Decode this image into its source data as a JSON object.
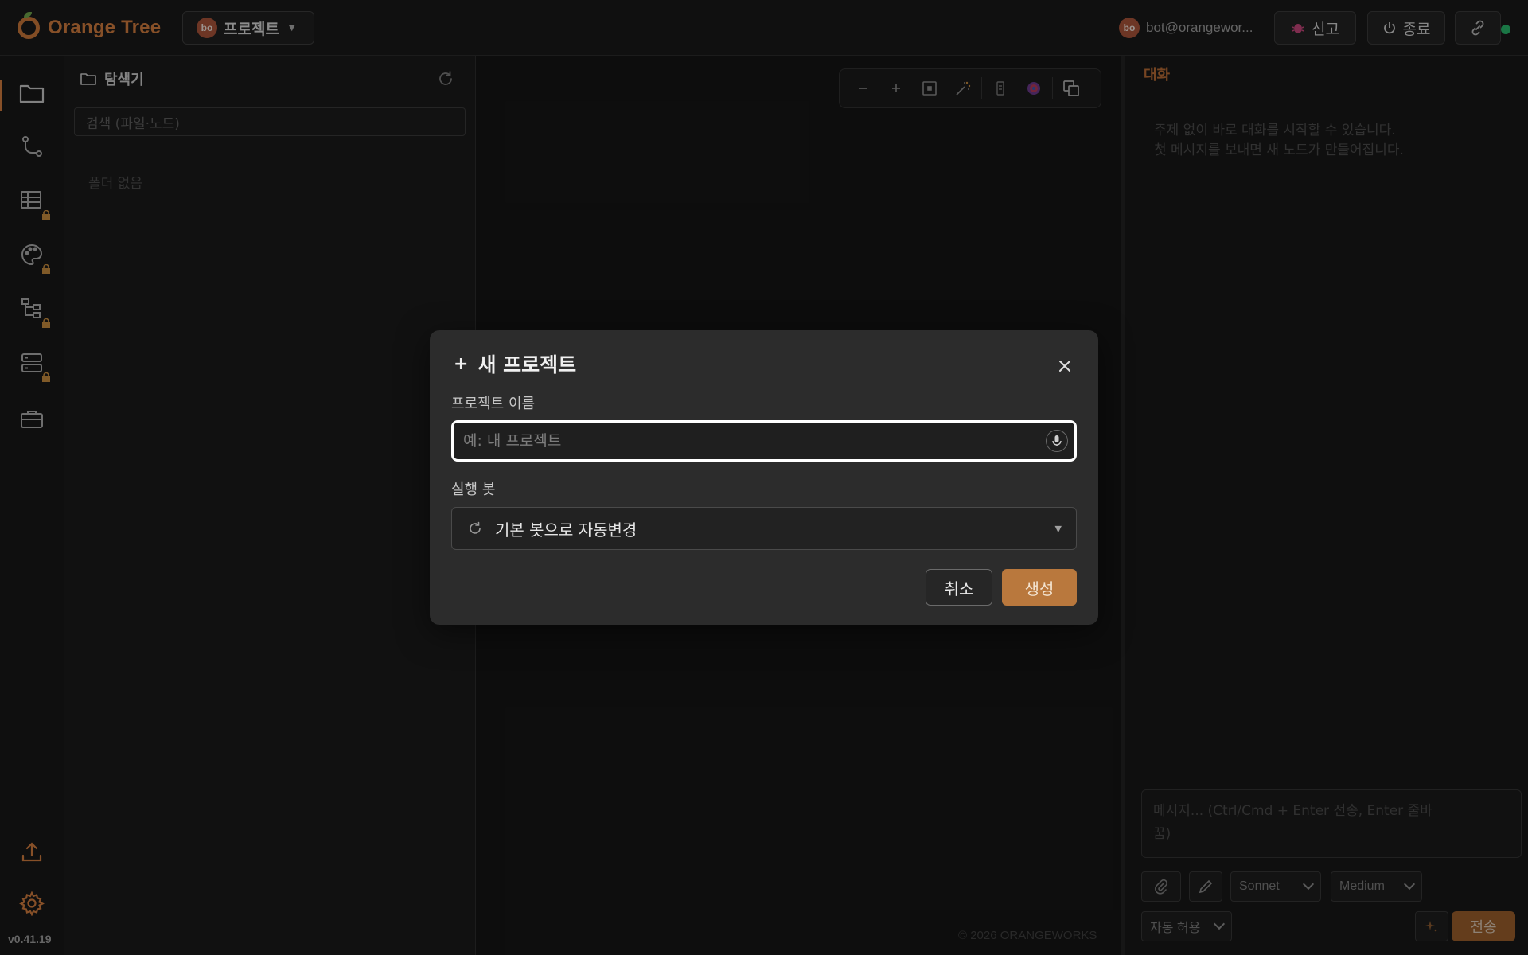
{
  "app": {
    "name": "Orange Tree"
  },
  "header": {
    "project_avatar": "bo",
    "project_label": "프로젝트",
    "user_avatar": "bo",
    "user_email": "bot@orangewor...",
    "report_label": "신고",
    "quit_label": "종료",
    "status_color": "#28b66a"
  },
  "rail": {
    "items": [
      {
        "icon": "folder-icon",
        "locked": false,
        "active": true
      },
      {
        "icon": "git-branch-icon",
        "locked": false
      },
      {
        "icon": "table-icon",
        "locked": true
      },
      {
        "icon": "palette-icon",
        "locked": true
      },
      {
        "icon": "hierarchy-icon",
        "locked": true
      },
      {
        "icon": "server-icon",
        "locked": true
      },
      {
        "icon": "briefcase-icon",
        "locked": false
      }
    ],
    "bottom": [
      {
        "icon": "upload-icon"
      },
      {
        "icon": "settings-icon"
      }
    ],
    "version": "v0.41.19"
  },
  "explorer": {
    "title": "탐색기",
    "search_placeholder": "검색 (파일·노드)",
    "empty_text": "폴더 없음"
  },
  "canvas": {
    "tools": [
      "zoom-out-icon",
      "zoom-in-icon",
      "fit-view-icon",
      "magic-wand-icon",
      "minimap-icon",
      "target-icon",
      "layers-icon"
    ],
    "copyright": "© 2026 ORANGEWORKS"
  },
  "chat": {
    "title": "대화",
    "hint_line1": "주제 없이 바로 대화를 시작할 수 있습니다.",
    "hint_line2": "첫 메시지를 보내면 새 노드가 만들어집니다.",
    "input_placeholder_line1": "메시지... (Ctrl/Cmd + Enter 전송, Enter 줄바",
    "input_placeholder_line2": "꿈)",
    "model": "Sonnet",
    "effort": "Medium",
    "permission": "자동 허용",
    "send_label": "전송"
  },
  "modal": {
    "title": "새 프로젝트",
    "name_label": "프로젝트 이름",
    "name_placeholder": "예: 내 프로젝트",
    "name_value": "",
    "bot_label": "실행 봇",
    "bot_value": "기본 봇으로 자동변경",
    "cancel_label": "취소",
    "create_label": "생성"
  },
  "colors": {
    "accent": "#cf7c3e",
    "create_button": "#b9783d",
    "send_button": "#9a5f2c",
    "modal_bg": "#2c2c2c"
  }
}
